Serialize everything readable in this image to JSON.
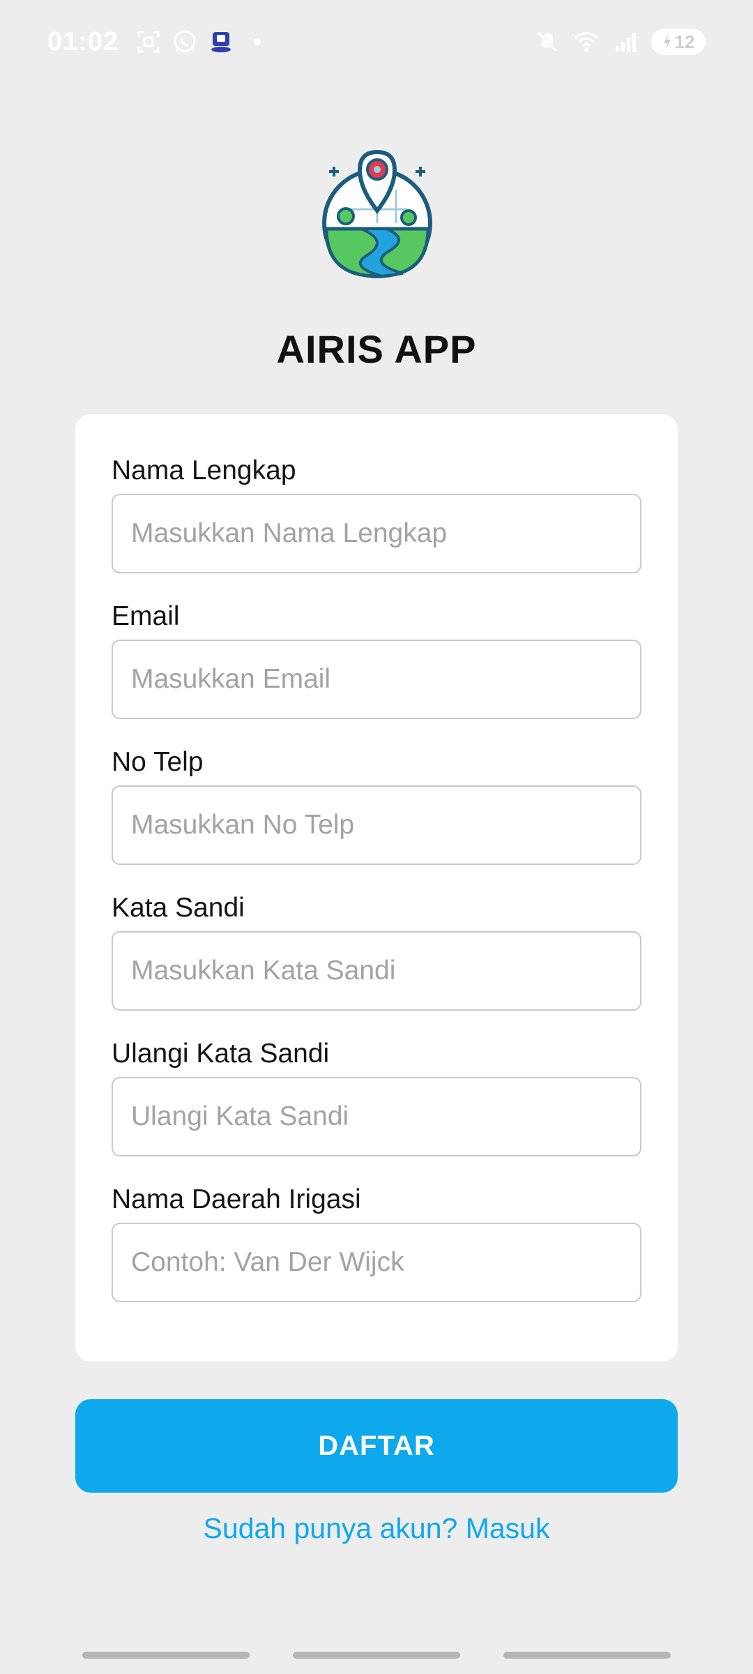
{
  "status_bar": {
    "time": "01:02",
    "battery": "12",
    "left_icons": [
      "screenshot-icon",
      "whatsapp-icon",
      "app-badge-icon"
    ],
    "right_icons": [
      "mute-icon",
      "wifi-icon",
      "signal-icon",
      "battery-icon"
    ]
  },
  "app": {
    "title": "AIRIS APP",
    "logo_icon": "map-pin-river-logo"
  },
  "form": {
    "fields": [
      {
        "label": "Nama Lengkap",
        "placeholder": "Masukkan Nama Lengkap",
        "value": ""
      },
      {
        "label": "Email",
        "placeholder": "Masukkan Email",
        "value": ""
      },
      {
        "label": "No Telp",
        "placeholder": "Masukkan No Telp",
        "value": ""
      },
      {
        "label": "Kata Sandi",
        "placeholder": "Masukkan Kata Sandi",
        "value": ""
      },
      {
        "label": "Ulangi Kata Sandi",
        "placeholder": "Ulangi Kata Sandi",
        "value": ""
      },
      {
        "label": "Nama Daerah Irigasi",
        "placeholder": "Contoh: Van Der Wijck",
        "value": ""
      }
    ],
    "submit_label": "DAFTAR",
    "login_link": "Sudah punya akun? Masuk"
  },
  "colors": {
    "accent": "#0ea8ec",
    "background": "#ededed",
    "card": "#ffffff"
  }
}
